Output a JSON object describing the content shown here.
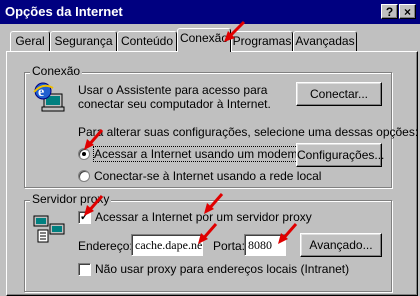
{
  "window": {
    "title": "Opções da Internet",
    "help_button": "?",
    "close_button": "×"
  },
  "tabs": [
    {
      "label": "Geral"
    },
    {
      "label": "Segurança"
    },
    {
      "label": "Conteúdo"
    },
    {
      "label": "Conexão",
      "active": true
    },
    {
      "label": "Programas"
    },
    {
      "label": "Avançadas"
    }
  ],
  "connection_group": {
    "legend": "Conexão",
    "wizard_text_1": "Usar o Assistente para acesso para",
    "wizard_text_2": "conectar seu computador à Internet.",
    "connect_button": "Conectar...",
    "options_text": "Para alterar suas configurações, selecione uma dessas opções:",
    "radio_modem": "Acessar a Internet usando um modem",
    "radio_modem_selected": true,
    "settings_button": "Configurações...",
    "radio_lan": "Conectar-se à Internet usando a rede local"
  },
  "proxy_group": {
    "legend": "Servidor proxy",
    "use_proxy_label": "Acessar a Internet por um servidor proxy",
    "use_proxy_checked": true,
    "address_label": "Endereço:",
    "address_value": "cache.dape.net",
    "port_label": "Porta:",
    "port_value": "8080",
    "advanced_button": "Avançado...",
    "bypass_local_label": "Não usar proxy para endereços locais (Intranet)",
    "bypass_local_checked": false
  },
  "colors": {
    "title_bar": "#000080",
    "dialog_bg": "#c0c0c0",
    "annotation_arrow": "#e00000"
  },
  "icons": [
    "help-icon",
    "close-icon",
    "internet-connection-wizard-icon",
    "proxy-network-icon",
    "annotation-arrow-icon"
  ]
}
